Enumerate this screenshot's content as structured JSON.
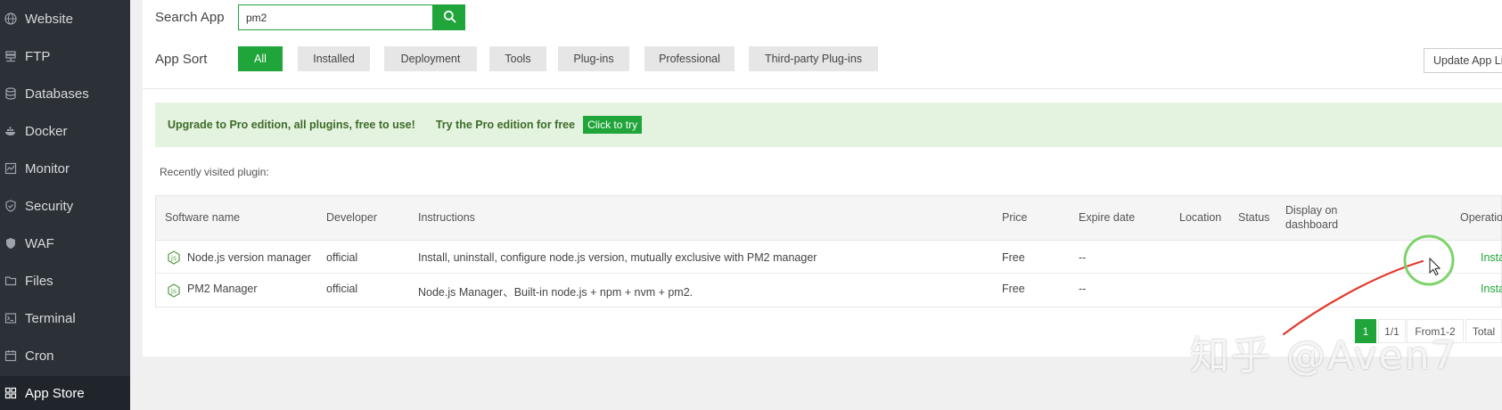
{
  "sidebar": {
    "items": [
      {
        "label": "Website",
        "icon": "globe-icon"
      },
      {
        "label": "FTP",
        "icon": "ftp-icon"
      },
      {
        "label": "Databases",
        "icon": "database-icon"
      },
      {
        "label": "Docker",
        "icon": "docker-icon"
      },
      {
        "label": "Monitor",
        "icon": "monitor-icon"
      },
      {
        "label": "Security",
        "icon": "shield-icon"
      },
      {
        "label": "WAF",
        "icon": "waf-shield-icon"
      },
      {
        "label": "Files",
        "icon": "folder-icon"
      },
      {
        "label": "Terminal",
        "icon": "terminal-icon"
      },
      {
        "label": "Cron",
        "icon": "calendar-icon"
      },
      {
        "label": "App Store",
        "icon": "grid-icon",
        "active": true
      }
    ]
  },
  "search": {
    "label": "Search App",
    "value": "pm2"
  },
  "sort": {
    "label": "App Sort",
    "buttons": [
      "All",
      "Installed",
      "Deployment",
      "Tools",
      "Plug-ins",
      "Professional",
      "Third-party Plug-ins"
    ],
    "active": "All"
  },
  "update_button": "Update App Li",
  "promo": {
    "headline": "Upgrade to Pro edition, all plugins, free to use!",
    "try_text": "Try the Pro edition for free",
    "button": "Click to try"
  },
  "recent_label": "Recently visited plugin:",
  "table": {
    "headers": [
      "Software name",
      "Developer",
      "Instructions",
      "Price",
      "Expire date",
      "Location",
      "Status",
      "Display on dashboard",
      "Operatio"
    ],
    "rows": [
      {
        "name": "Node.js version manager",
        "developer": "official",
        "instructions": "Install, uninstall, configure node.js version, mutually exclusive with PM2 manager",
        "price": "Free",
        "expire": "--",
        "operation": "Insta"
      },
      {
        "name": "PM2 Manager",
        "developer": "official",
        "instructions": "Node.js Manager、Built-in node.js + npm + nvm + pm2.",
        "price": "Free",
        "expire": "--",
        "operation": "Insta"
      }
    ]
  },
  "pagination": {
    "current": "1",
    "pages": "1/1",
    "range": "From1-2",
    "total": "Total"
  },
  "watermark": "知乎 @Aven7",
  "colors": {
    "accent": "#20a53a",
    "sidebar": "#2c3138",
    "promo_bg": "#e4f3df"
  }
}
